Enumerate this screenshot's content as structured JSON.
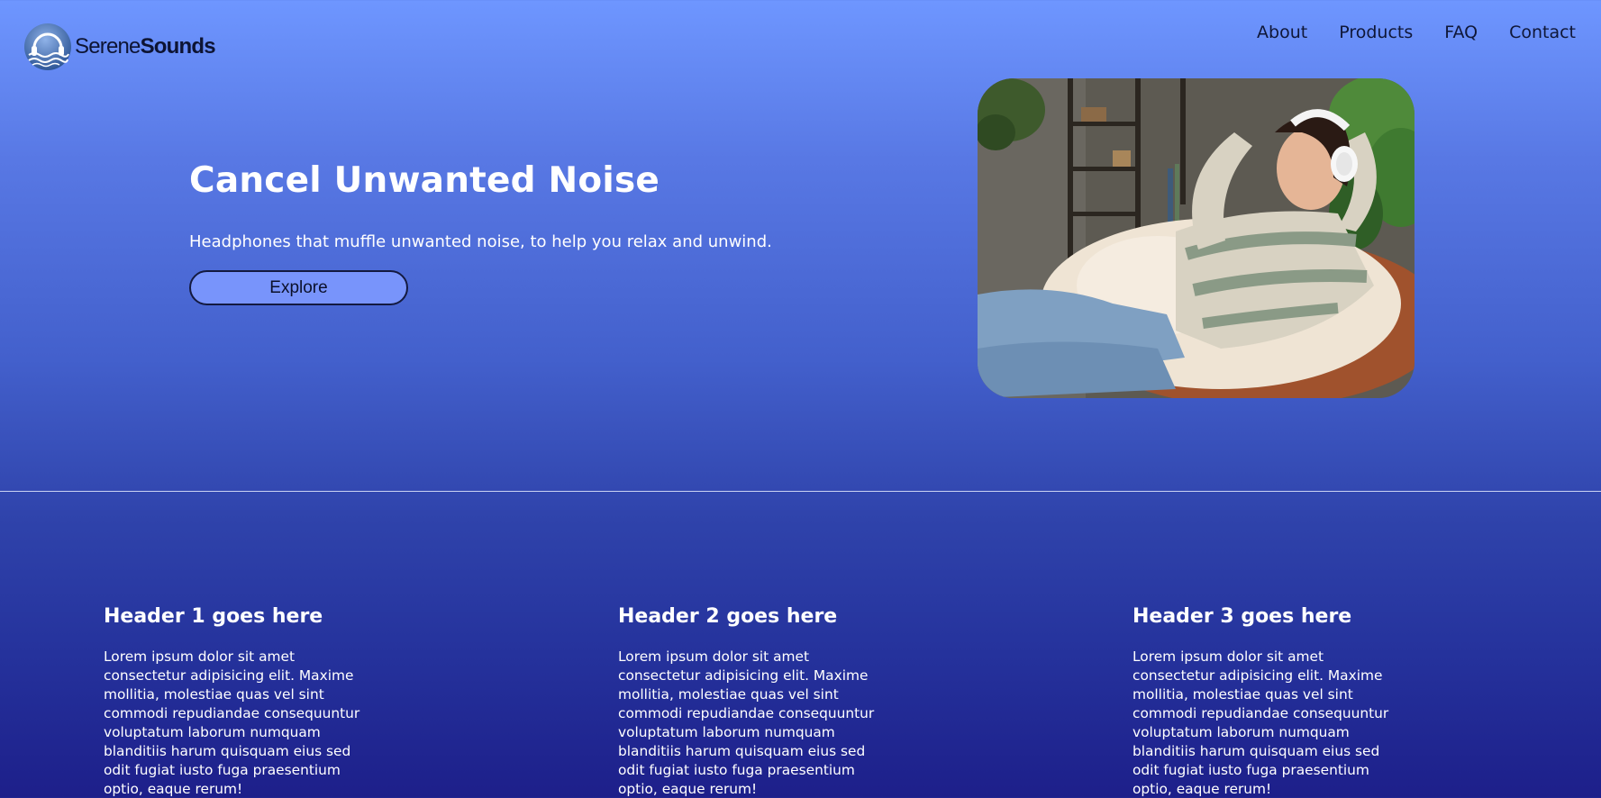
{
  "brand": {
    "name_regular": "Serene",
    "name_bold": "Sounds",
    "logo_icon": "headphones-waves-icon"
  },
  "nav": {
    "items": [
      {
        "label": "About"
      },
      {
        "label": "Products"
      },
      {
        "label": "FAQ"
      },
      {
        "label": "Contact"
      }
    ]
  },
  "hero": {
    "title": "Cancel Unwanted Noise",
    "subtitle": "Headphones that muffle unwanted noise, to help you relax and unwind.",
    "button_label": "Explore",
    "image_alt": "Woman relaxing in a chair wearing white headphones"
  },
  "features": [
    {
      "header": "Header 1 goes here",
      "body": "Lorem ipsum dolor sit amet consectetur adipisicing elit. Maxime mollitia, molestiae quas vel sint commodi repudiandae consequuntur voluptatum laborum numquam blanditiis harum quisquam eius sed odit fugiat iusto fuga praesentium optio, eaque rerum!"
    },
    {
      "header": "Header 2 goes here",
      "body": "Lorem ipsum dolor sit amet consectetur adipisicing elit. Maxime mollitia, molestiae quas vel sint commodi repudiandae consequuntur voluptatum laborum numquam blanditiis harum quisquam eius sed odit fugiat iusto fuga praesentium optio, eaque rerum!"
    },
    {
      "header": "Header 3 goes here",
      "body": "Lorem ipsum dolor sit amet consectetur adipisicing elit. Maxime mollitia, molestiae quas vel sint commodi repudiandae consequuntur voluptatum laborum numquam blanditiis harum quisquam eius sed odit fugiat iusto fuga praesentium optio, eaque rerum!"
    }
  ],
  "colors": {
    "gradient_top": "#6e96ff",
    "gradient_bottom": "#1d1f8a",
    "button_fill": "#7894fb",
    "nav_text": "#0f1738",
    "divider": "#e6ecff"
  }
}
